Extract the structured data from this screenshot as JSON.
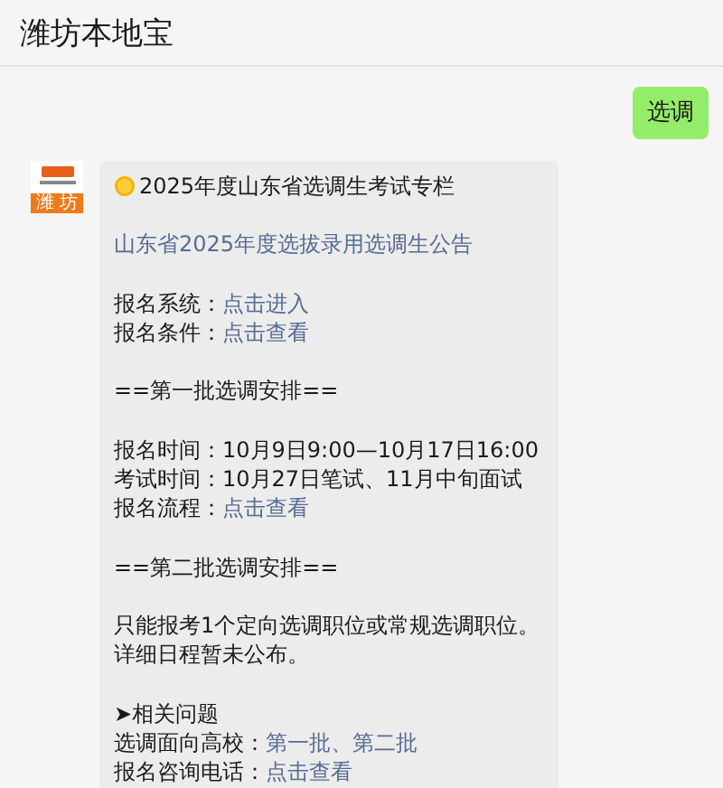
{
  "header": {
    "title": "潍坊本地宝"
  },
  "messages": [
    {
      "kind": "sent",
      "text": "选调"
    },
    {
      "kind": "received",
      "avatar": {
        "caption": "潍 坊"
      },
      "groups": [
        [
          {
            "kind": "title",
            "text": "2025年度山东省选调生考试专栏"
          }
        ],
        [
          {
            "kind": "link",
            "text": "山东省2025年度选拔录用选调生公告"
          }
        ],
        [
          {
            "kind": "text",
            "text": "报名系统：",
            "link": "点击进入"
          },
          {
            "kind": "text",
            "text": "报名条件：",
            "link": "点击查看"
          }
        ],
        [
          {
            "kind": "text",
            "text": "==第一批选调安排=="
          }
        ],
        [
          {
            "kind": "text",
            "text": "报名时间：10月9日9:00—10月17日16:00"
          },
          {
            "kind": "text",
            "text": "考试时间：10月27日笔试、11月中旬面试"
          },
          {
            "kind": "text",
            "text": "报名流程：",
            "link": "点击查看"
          }
        ],
        [
          {
            "kind": "text",
            "text": "==第二批选调安排=="
          }
        ],
        [
          {
            "kind": "text",
            "text": "只能报考1个定向选调职位或常规选调职位。"
          },
          {
            "kind": "text",
            "text": "详细日程暂未公布。"
          }
        ],
        [
          {
            "kind": "text",
            "text": "➤相关问题"
          },
          {
            "kind": "text",
            "text": "选调面向高校：",
            "link": "第一批、第二批"
          },
          {
            "kind": "text",
            "text": "报名咨询电话：",
            "link": "点击查看"
          }
        ]
      ]
    }
  ]
}
